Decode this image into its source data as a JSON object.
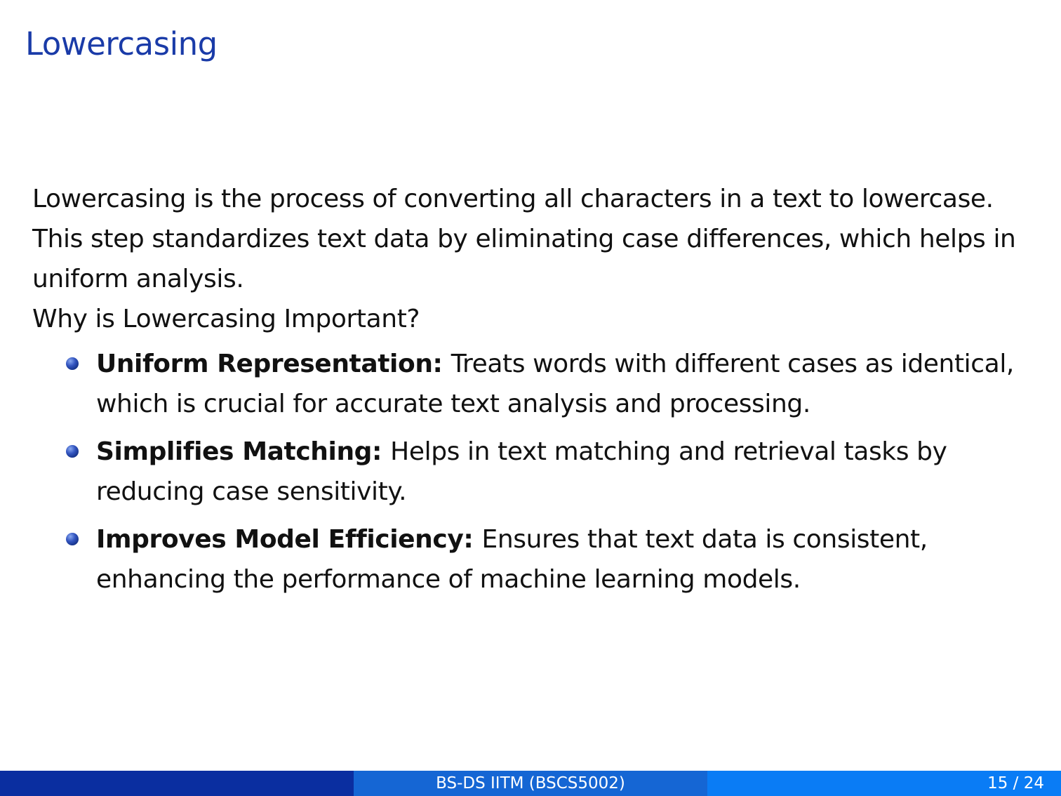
{
  "slide": {
    "title": "Lowercasing",
    "paragraph": "Lowercasing is the process of converting all characters in a text to lowercase.  This step standardizes text data by eliminating case differences, which helps in uniform analysis.",
    "question": "Why is Lowercasing Important?",
    "bullets": [
      {
        "term": "Uniform Representation:",
        "text": "Treats words with different cases as identical, which is crucial for accurate text analysis and processing."
      },
      {
        "term": "Simplifies Matching:",
        "text": "Helps in text matching and retrieval tasks by reducing case sensitivity."
      },
      {
        "term": "Improves Model Efficiency:",
        "text": "Ensures that text data is consistent, enhancing the performance of machine learning models."
      }
    ]
  },
  "footer": {
    "course": "BS-DS IITM (BSCS5002)",
    "page": "15 / 24"
  },
  "colors": {
    "title": "#1a3ba8",
    "footer_left": "#0a2ea0",
    "footer_mid": "#1566d4",
    "footer_right": "#0a7cf5"
  }
}
